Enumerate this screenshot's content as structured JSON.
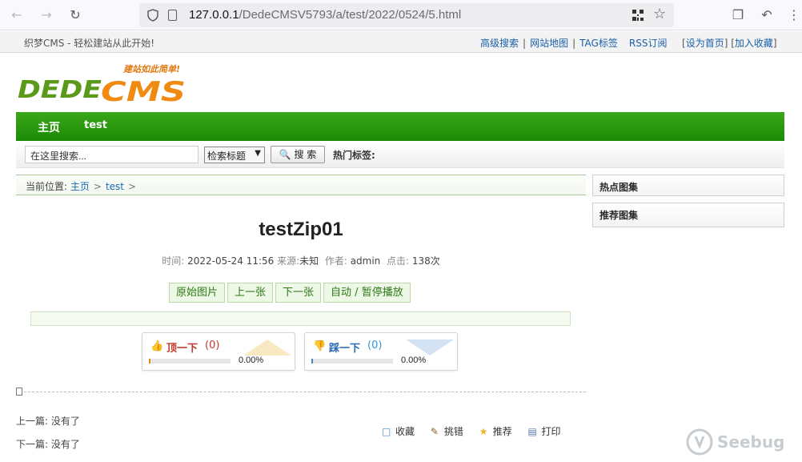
{
  "browser": {
    "url_host": "127.0.0.1",
    "url_path": "/DedeCMSV5793/a/test/2022/0524/5.html"
  },
  "topbar": {
    "welcome": "织梦CMS - 轻松建站从此开始!",
    "links": [
      "高级搜索",
      "网站地图",
      "TAG标签",
      "RSS订阅"
    ],
    "set_home": "设为首页",
    "add_fav": "加入收藏"
  },
  "logo": {
    "text": "DEDECMS",
    "slogan": "建站如此简单!"
  },
  "nav": {
    "items": [
      "主页",
      "test"
    ]
  },
  "search": {
    "placeholder_value": "在这里搜索...",
    "select_value": "检索标题",
    "button": "搜 索",
    "hot_label": "热门标签:"
  },
  "breadcrumb": {
    "label": "当前位置:",
    "home": "主页",
    "category": "test"
  },
  "sidebar": {
    "box1": "热点图集",
    "box2": "推荐图集"
  },
  "article": {
    "title": "testZip01",
    "time_label": "时间:",
    "time": "2022-05-24 11:56",
    "source_label": "来源:",
    "source": "未知",
    "author_label": "作者:",
    "author": "admin",
    "clicks_label": "点击:",
    "clicks": "138次"
  },
  "pic_buttons": [
    "原始图片",
    "上一张",
    "下一张",
    "自动 / 暂停播放"
  ],
  "vote": {
    "up_label": "顶一下",
    "up_count": "(0)",
    "up_pct": "0.00%",
    "down_label": "踩一下",
    "down_count": "(0)",
    "down_pct": "0.00%",
    "up_fraction": 0.0,
    "down_fraction": 0.0
  },
  "prev_next": {
    "prev": "上一篇: 没有了",
    "next": "下一篇: 没有了"
  },
  "actions": [
    "收藏",
    "挑错",
    "推荐",
    "打印"
  ],
  "watermark": "Seebug",
  "colors": {
    "nav_green": "#1c8a05",
    "link_blue": "#1a6cb5",
    "up_red": "#c0392b",
    "down_blue": "#2a6cb5"
  }
}
